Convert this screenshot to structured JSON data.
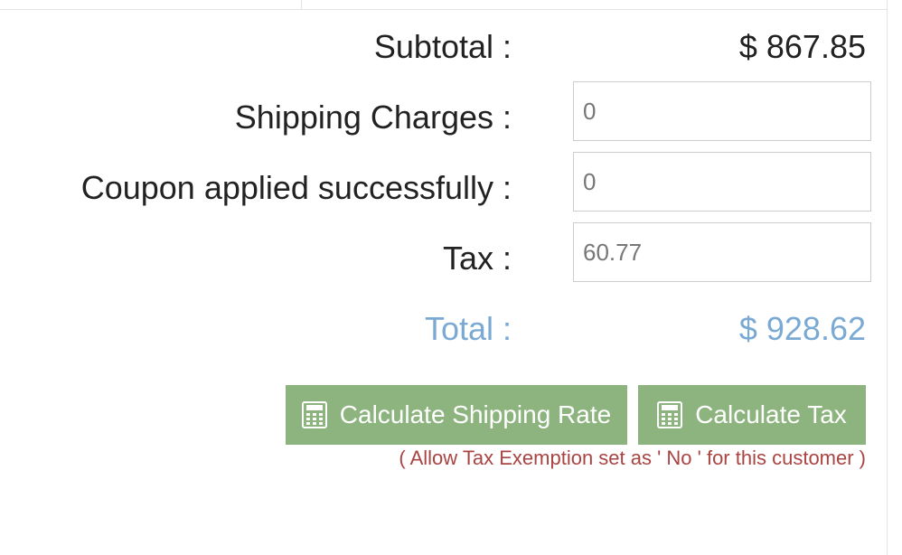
{
  "summary": {
    "subtotal_label": "Subtotal :",
    "subtotal_value": "$ 867.85",
    "shipping_label": "Shipping Charges :",
    "shipping_value": "0",
    "coupon_label": "Coupon applied successfully :",
    "coupon_value": "0",
    "tax_label": "Tax :",
    "tax_value": "60.77",
    "total_label": "Total :",
    "total_value": "$ 928.62"
  },
  "actions": {
    "shipping_button_label": "Calculate Shipping Rate",
    "tax_button_label": "Calculate Tax",
    "button_icon": "calculator-icon"
  },
  "notice": {
    "text": "( Allow Tax Exemption set as ' No ' for this customer )"
  },
  "colors": {
    "accent_total": "#7aa9d3",
    "button_green": "#8db47f",
    "notice_red": "#a94442"
  }
}
